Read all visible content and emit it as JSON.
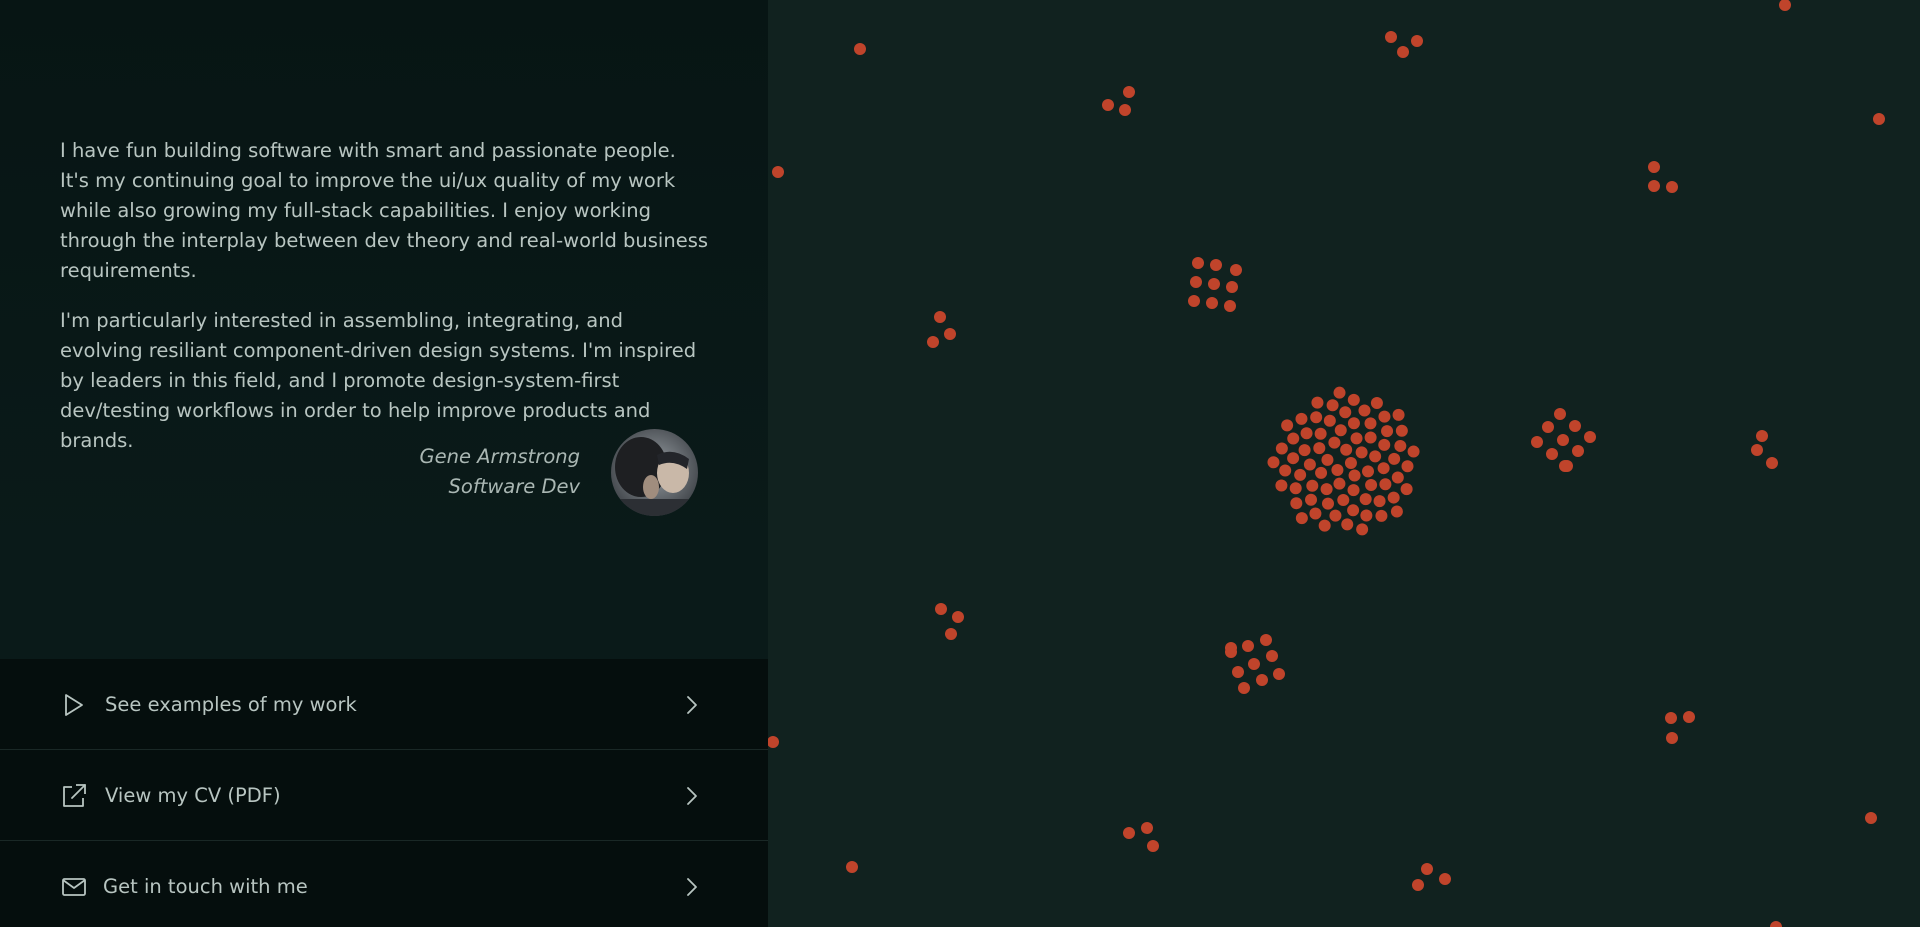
{
  "intro": {
    "paragraph_1": "I have fun building software with smart and passionate people. It's my continuing goal to improve the ui/ux quality of my work while also growing my full-stack capabilities. I enjoy working through the interplay between dev theory and real-world business requirements.",
    "paragraph_2": "I'm particularly interested in assembling, integrating, and evolving resiliant component-driven design systems. I'm inspired by leaders in this field, and I promote design-system-first dev/testing workflows in order to help improve products and brands."
  },
  "signature": {
    "name": "Gene Armstrong",
    "role": "Software Dev"
  },
  "links": [
    {
      "label": "See examples of my work",
      "icon": "play-icon"
    },
    {
      "label": "View my CV (PDF)",
      "icon": "external-link-icon"
    },
    {
      "label": "Get in touch with me",
      "icon": "mail-icon"
    }
  ],
  "colors": {
    "background": "#11221f",
    "panel": "#071514",
    "dot": "#c0442b",
    "text": "#b8c5c1"
  }
}
